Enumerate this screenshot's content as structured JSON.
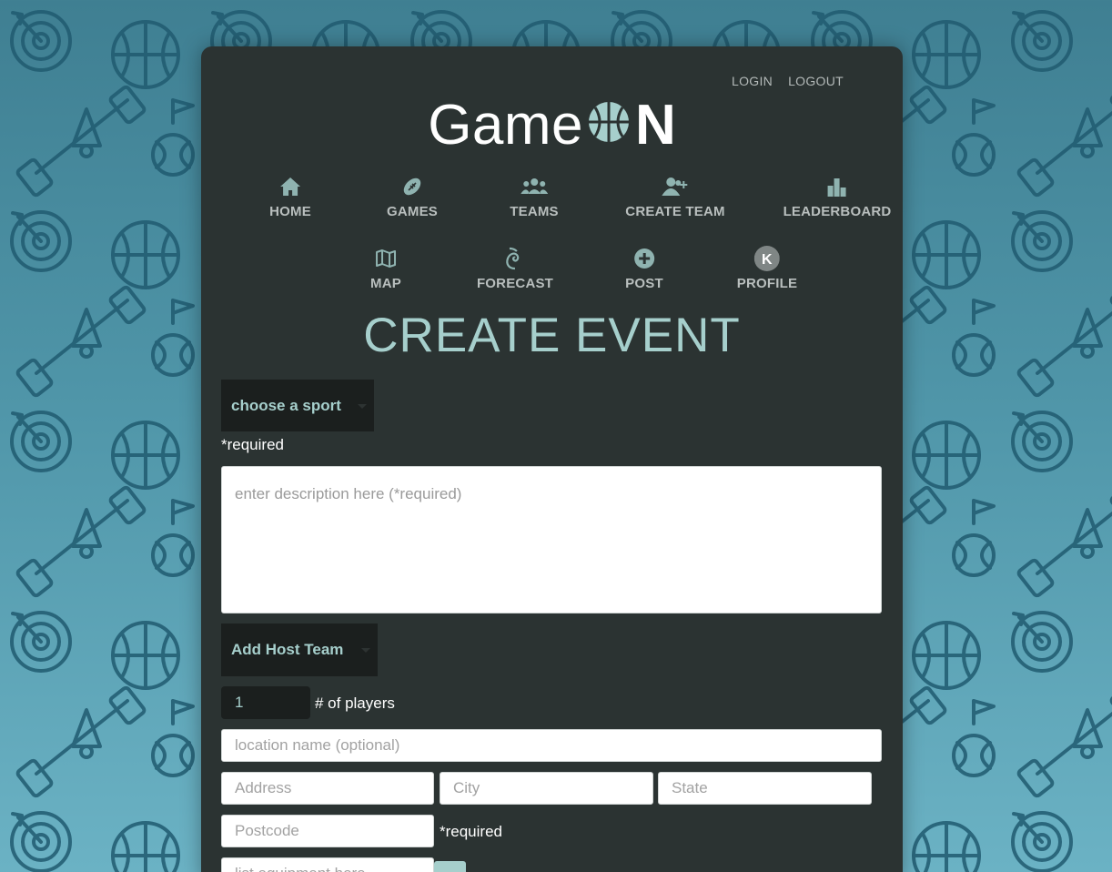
{
  "header": {
    "login_label": "LOGIN",
    "logout_label": "LOGOUT",
    "logo": {
      "part1": "Game",
      "part2": "N"
    }
  },
  "nav": {
    "row1": [
      {
        "label": "HOME",
        "icon": "home-icon"
      },
      {
        "label": "GAMES",
        "icon": "football-icon"
      },
      {
        "label": "TEAMS",
        "icon": "users-icon"
      },
      {
        "label": "CREATE TEAM",
        "icon": "user-plus-icon"
      },
      {
        "label": "LEADERBOARD",
        "icon": "bar-chart-icon"
      }
    ],
    "row2": [
      {
        "label": "MAP",
        "icon": "map-icon"
      },
      {
        "label": "FORECAST",
        "icon": "tornado-icon"
      },
      {
        "label": "POST",
        "icon": "plus-circle-icon"
      },
      {
        "label": "PROFILE",
        "icon": "avatar-icon",
        "avatar_letter": "K"
      }
    ]
  },
  "page": {
    "title": "CREATE EVENT"
  },
  "form": {
    "sport_dropdown_label": "choose a sport",
    "required_note": "*required",
    "description_placeholder": "enter description here (*required)",
    "host_team_label": "Add Host Team",
    "players_value": "1",
    "players_label": "# of players",
    "location_placeholder": "location name (optional)",
    "address_placeholder": "Address",
    "city_placeholder": "City",
    "state_placeholder": "State",
    "postcode_placeholder": "Postcode",
    "postcode_required_note": "*required",
    "equipment_placeholder": "list equipment here"
  },
  "colors": {
    "panel": "#2b3332",
    "accent": "#a6cfcc",
    "nav_text": "#b9bfbe",
    "background": "#4f95a8",
    "dropdown": "#1b1f1e"
  }
}
